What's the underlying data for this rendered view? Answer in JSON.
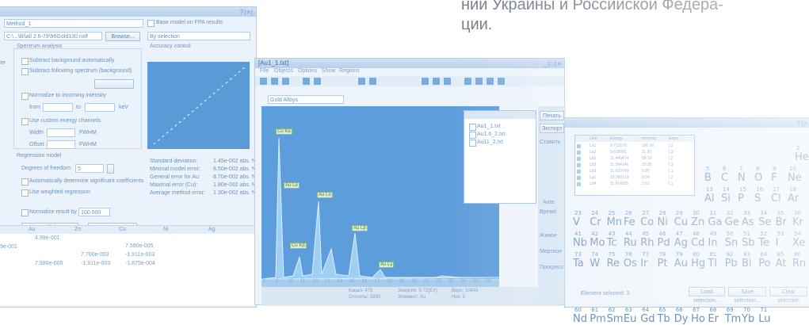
{
  "caption": {
    "line1": "ний Украины и Российской Федера-",
    "line2": "ции."
  },
  "left_window": {
    "method_value": "Method_1",
    "file_value": "C:\\...\\Bi\\all 2.6-79\\96Gold130.nxlf",
    "browse_label": "Browse...",
    "base_model_label": "Base model on FPA results",
    "by_selection_value": "By selection",
    "spectrum_analysis_label": "Spectrum analysis",
    "accuracy_control_label": "Accuracy control",
    "options": [
      "Subtract background automatically",
      "Subtract following spectrum (background)",
      "Normalize to incoming intensity",
      "Use custom energy channels",
      "Width",
      "Offset"
    ],
    "from_label": "from",
    "to_label": "to",
    "kev_label": "keV",
    "fwhm_label": "FWHM",
    "regression_model_label": "Regression model",
    "degree_label": "Degrees of freedom:",
    "degree_value": "5",
    "auto_coeff_label": "Automatically determine significant coefficients",
    "weighted_label": "Use weighted regression",
    "normalize_label": "Normalize result by",
    "normalize_value": "100.000",
    "hide_coeff_label": "Hide coefficients <<",
    "calc_label": "Calculate method",
    "stats": [
      {
        "k": "Standard deviation:",
        "v": "1.45e-002 abs. %"
      },
      {
        "k": "Minimal model error:",
        "v": "8.50e-002 abs. %"
      },
      {
        "k": "General error for Au:",
        "v": "8.70e-002 abs. %"
      },
      {
        "k": "Maximal error (Cu):",
        "v": "1.80e-002 abs. %"
      },
      {
        "k": "Average method error:",
        "v": "1.30e-002 abs. %"
      }
    ],
    "table": {
      "headers": [
        "Au",
        "Zn",
        "Cu",
        "Ni",
        "Ag"
      ],
      "cells": [
        "4.99e-001",
        "7.590e-005",
        "7.700e-003",
        "-1.911e-003",
        "7.580e-005",
        "-1.911e-003",
        "-1.875e-004"
      ],
      "left_cell": "9e-001"
    },
    "side_label": "ter"
  },
  "mid_window": {
    "title": "[Au1_1.txt]",
    "menu": [
      "File",
      "Objects",
      "Options",
      "Show",
      "Regions"
    ],
    "gold_alloys": "Gold Alloys",
    "peaks": [
      "Cu Kα",
      "Au Lα",
      "Au Lα",
      "Cu Kβ",
      "Au Lβ",
      "Au Lγ"
    ],
    "x_ticks": [
      "8",
      "9",
      "10",
      "11",
      "12",
      "13",
      "14",
      "15",
      "16",
      "17",
      "18",
      "19",
      "20",
      "21",
      "22",
      "23",
      "24",
      "25",
      "26"
    ],
    "legend": [
      "Au1_1.txt",
      "Au1.6_2.txt",
      "Au11_2.txt"
    ],
    "status": [
      "Канал: 475",
      "Энергия: 9.72(ЕУ)",
      "Отсчеты: 5830",
      "Элемент: Au",
      "Верх: 10845",
      "Низ: 0"
    ],
    "side": [
      "Печать",
      "Экспорт",
      "Ставить",
      "Auto",
      "Время",
      "Живое",
      "Мертвое",
      "Прогресс"
    ]
  },
  "right_window": {
    "au": {
      "z": "79",
      "s": "Au"
    },
    "row1": [
      [
        "5",
        "B"
      ],
      [
        "6",
        "C"
      ],
      [
        "7",
        "N"
      ],
      [
        "8",
        "O"
      ],
      [
        "9",
        "F"
      ],
      [
        "10",
        "Ne"
      ]
    ],
    "row2": [
      [
        "13",
        "Al"
      ],
      [
        "14",
        "Si"
      ],
      [
        "15",
        "P"
      ],
      [
        "16",
        "S"
      ],
      [
        "17",
        "Cl"
      ],
      [
        "18",
        "Ar"
      ]
    ],
    "row3": [
      [
        "23",
        "V"
      ],
      [
        "24",
        "Cr"
      ],
      [
        "25",
        "Mn"
      ],
      [
        "26",
        "Fe"
      ],
      [
        "27",
        "Co"
      ],
      [
        "28",
        "Ni"
      ],
      [
        "29",
        "Cu"
      ],
      [
        "30",
        "Zn"
      ],
      [
        "31",
        "Ga"
      ],
      [
        "32",
        "Ge"
      ],
      [
        "33",
        "As"
      ],
      [
        "34",
        "Se"
      ],
      [
        "35",
        "Br"
      ],
      [
        "36",
        "Kr"
      ]
    ],
    "row4": [
      [
        "41",
        "Nb"
      ],
      [
        "42",
        "Mo"
      ],
      [
        "43",
        "Tc"
      ],
      [
        "44",
        "Ru"
      ],
      [
        "45",
        "Rh"
      ],
      [
        "46",
        "Pd"
      ],
      [
        "47",
        "Ag"
      ],
      [
        "48",
        "Cd"
      ],
      [
        "49",
        "In"
      ],
      [
        "50",
        "Sn"
      ],
      [
        "51",
        "Sb"
      ],
      [
        "52",
        "Te"
      ],
      [
        "53",
        "I"
      ],
      [
        "54",
        "Xe"
      ]
    ],
    "row5": [
      [
        "73",
        "Ta"
      ],
      [
        "74",
        "W"
      ],
      [
        "75",
        "Re"
      ],
      [
        "76",
        "Os"
      ],
      [
        "77",
        "Ir"
      ],
      [
        "78",
        "Pt"
      ],
      [
        "79",
        "Au"
      ],
      [
        "80",
        "Hg"
      ],
      [
        "81",
        "Tl"
      ],
      [
        "82",
        "Pb"
      ],
      [
        "83",
        "Bi"
      ],
      [
        "84",
        "Po"
      ],
      [
        "85",
        "At"
      ],
      [
        "86",
        "Rn"
      ]
    ],
    "row6": [
      [
        "60",
        "Nd"
      ],
      [
        "61",
        "Pm"
      ],
      [
        "62",
        "Sm"
      ],
      [
        "63",
        "Eu"
      ],
      [
        "64",
        "Gd"
      ],
      [
        "65",
        "Tb"
      ],
      [
        "66",
        "Dy"
      ],
      [
        "67",
        "Ho"
      ],
      [
        "68",
        "Er"
      ],
      [
        "69",
        "Tm"
      ],
      [
        "70",
        "Yb"
      ],
      [
        "71",
        "Lu"
      ]
    ],
    "h": {
      "z": "2",
      "s": "He"
    },
    "elements_selected": "Element selected: 3",
    "load_label": "Load selection...",
    "save_label": "Save selection...",
    "clear_label": "Clear selection",
    "list_header": [
      "Line",
      "Energy",
      "Intensity",
      "Edge"
    ],
    "list_rows": [
      [
        "La1",
        "9.713176",
        "100.00",
        "L3"
      ],
      [
        "La2",
        "9.628081",
        "11.30",
        "L3"
      ],
      [
        "Lb1",
        "11.440474",
        "58.16",
        "L2"
      ],
      [
        "Lb2",
        "11.584146",
        "20.80",
        "L3"
      ],
      [
        "Lb3",
        "11.610769",
        "6.80",
        "L1"
      ],
      [
        "Lg1",
        "13.382113",
        "9.94",
        "L2"
      ],
      [
        "Lb4",
        "11.914255",
        "2.63",
        "L1"
      ]
    ]
  }
}
